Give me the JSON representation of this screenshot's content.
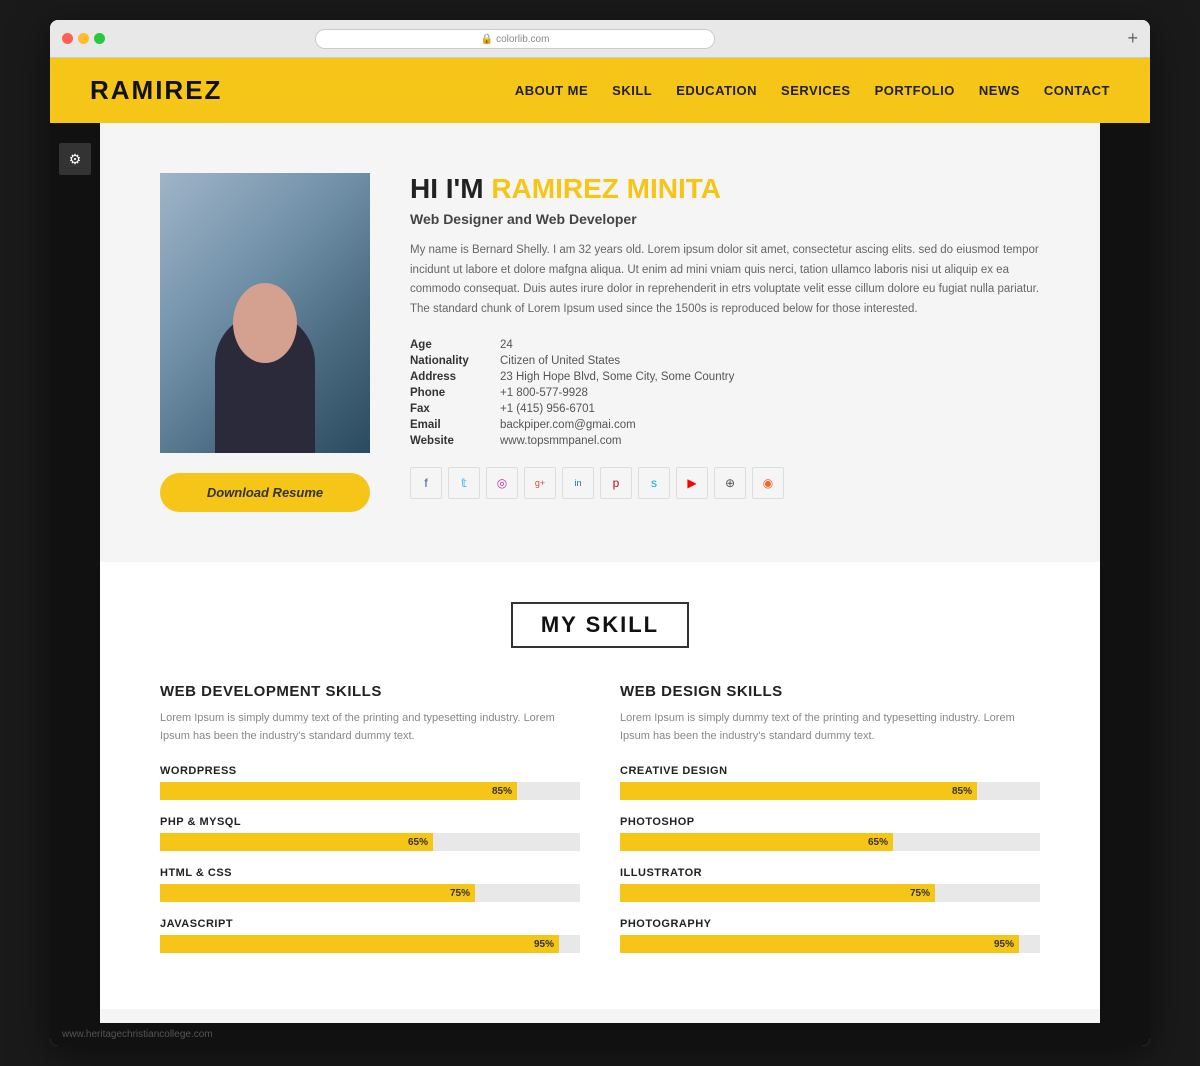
{
  "browser": {
    "url": "colorlib.com",
    "add_btn": "+"
  },
  "header": {
    "logo": "RAMIREZ",
    "nav": [
      {
        "label": "ABOUT ME",
        "id": "about"
      },
      {
        "label": "SKILL",
        "id": "skill"
      },
      {
        "label": "EDUCATION",
        "id": "education"
      },
      {
        "label": "SERVICES",
        "id": "services"
      },
      {
        "label": "PORTFOLIO",
        "id": "portfolio"
      },
      {
        "label": "NEWS",
        "id": "news"
      },
      {
        "label": "CONTACT",
        "id": "contact"
      }
    ]
  },
  "about": {
    "greeting": "HI I'M ",
    "name": "RAMIREZ MINITA",
    "job_title": "Web Designer and Web Developer",
    "bio": "My name is Bernard Shelly. I am 32 years old. Lorem ipsum dolor sit amet, consectetur ascing elits. sed do eiusmod tempor incidunt ut labore et dolore mafgna aliqua. Ut enim ad mini vniam quis nerci, tation ullamco laboris nisi ut aliquip ex ea commodo consequat. Duis autes irure dolor in reprehenderit in etrs voluptate velit esse cillum dolore eu fugiat nulla pariatur. The standard chunk of Lorem Ipsum used since the 1500s is reproduced below for those interested.",
    "info": [
      {
        "label": "Age",
        "value": "24"
      },
      {
        "label": "Nationality",
        "value": "Citizen of United States"
      },
      {
        "label": "Address",
        "value": "23 High Hope Blvd, Some City, Some Country"
      },
      {
        "label": "Phone",
        "value": "+1 800-577-9928"
      },
      {
        "label": "Fax",
        "value": "+1 (415) 956-6701"
      },
      {
        "label": "Email",
        "value": "backpiper.com@gmai.com"
      },
      {
        "label": "Website",
        "value": "www.topsmmpanel.com"
      }
    ],
    "download_btn": "Download Resume",
    "social_icons": [
      {
        "name": "facebook",
        "symbol": "f"
      },
      {
        "name": "twitter",
        "symbol": "t"
      },
      {
        "name": "instagram",
        "symbol": "i"
      },
      {
        "name": "google",
        "symbol": "g+"
      },
      {
        "name": "linkedin",
        "symbol": "in"
      },
      {
        "name": "pinterest",
        "symbol": "p"
      },
      {
        "name": "skype",
        "symbol": "s"
      },
      {
        "name": "youtube",
        "symbol": "▶"
      },
      {
        "name": "website",
        "symbol": "⊕"
      },
      {
        "name": "rss",
        "symbol": "◉"
      }
    ]
  },
  "skills": {
    "section_title": "MY SKILL",
    "left_col": {
      "title": "WEB DEVELOPMENT SKILLS",
      "desc": "Lorem Ipsum is simply dummy text of the printing and typesetting industry. Lorem Ipsum has been the industry's standard dummy text.",
      "items": [
        {
          "label": "WORDPRESS",
          "pct": 85
        },
        {
          "label": "PHP & MYSQL",
          "pct": 65
        },
        {
          "label": "HTML & CSS",
          "pct": 75
        },
        {
          "label": "JAVASCRIPT",
          "pct": 95
        }
      ]
    },
    "right_col": {
      "title": "WEB DESIGN SKILLS",
      "desc": "Lorem Ipsum is simply dummy text of the printing and typesetting industry. Lorem Ipsum has been the industry's standard dummy text.",
      "items": [
        {
          "label": "CREATIVE DESIGN",
          "pct": 85
        },
        {
          "label": "PHOTOSHOP",
          "pct": 65
        },
        {
          "label": "ILLUSTRATOR",
          "pct": 75
        },
        {
          "label": "PHOTOGRAPHY",
          "pct": 95
        }
      ]
    }
  },
  "footer": {
    "text": "www.heritagechristiancollege.com"
  }
}
